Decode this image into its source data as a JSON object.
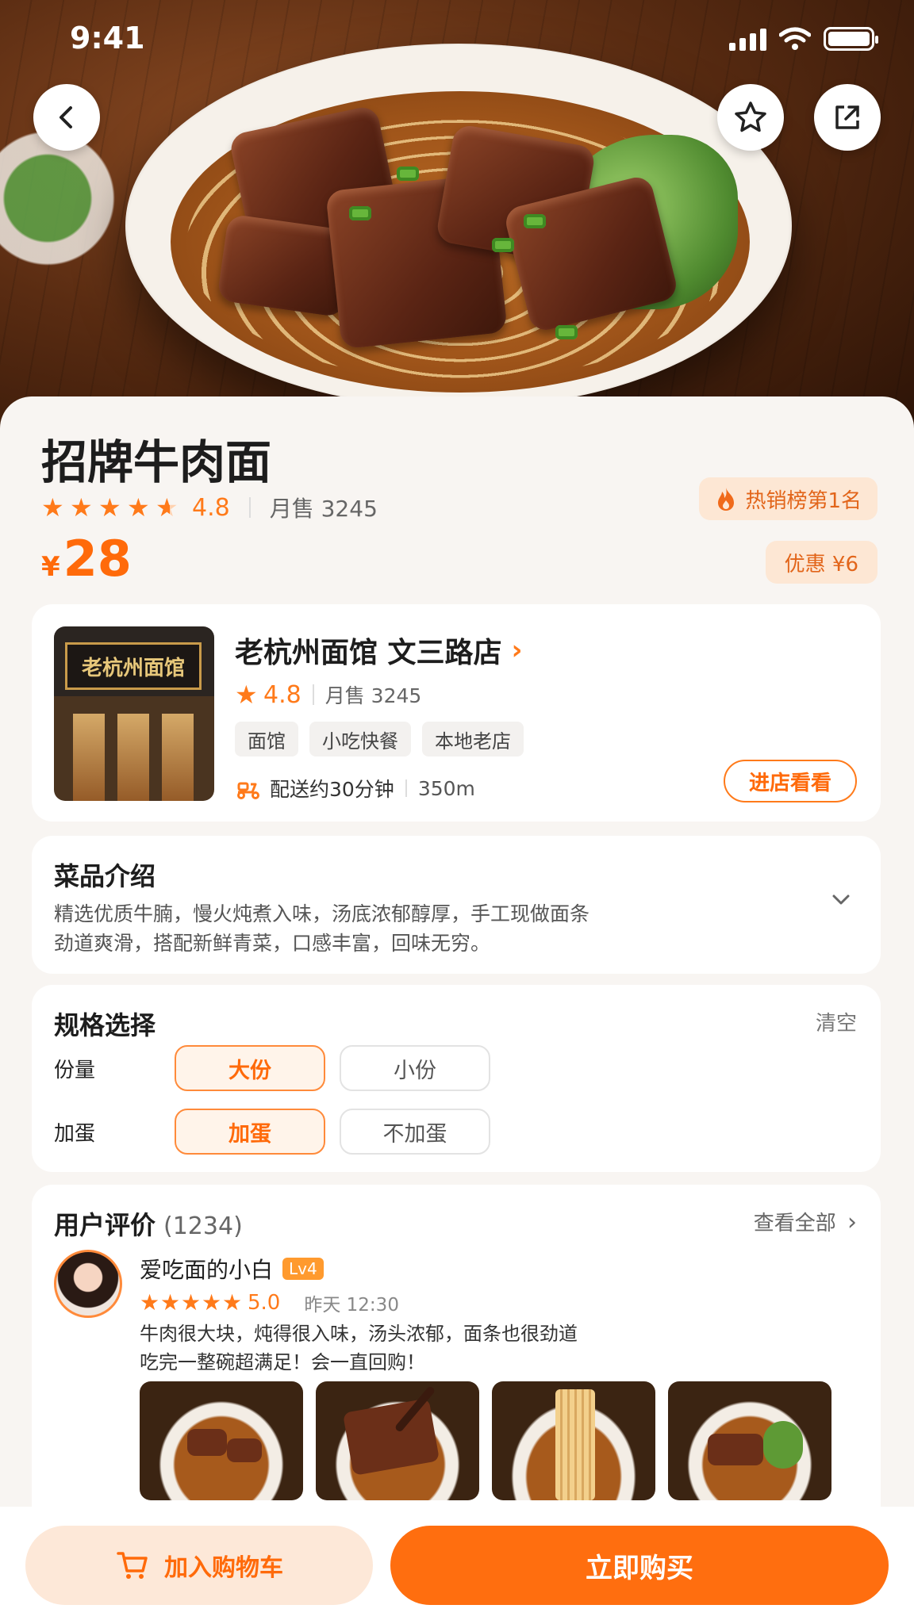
{
  "status_bar": {
    "time": "9:41"
  },
  "colors": {
    "accent": "#ff6e0f",
    "accent_light": "#fde8d8",
    "star": "#ff7a1a"
  },
  "product": {
    "title": "招牌牛肉面",
    "rating": "4.8",
    "sales": "月售 3245",
    "currency": "¥",
    "price": "28",
    "hot_badge": "热销榜第1名",
    "discount_badge": "优惠 ¥6"
  },
  "shop": {
    "sign_text": "老杭州面馆",
    "name": "老杭州面馆 文三路店",
    "rating": "4.8",
    "sales": "月售 3245",
    "tags": [
      "面馆",
      "小吃快餐",
      "本地老店"
    ],
    "delivery": "配送约30分钟",
    "distance": "350m",
    "enter_label": "进店看看"
  },
  "description": {
    "title": "菜品介绍",
    "line1": "精选优质牛腩，慢火炖煮入味，汤底浓郁醇厚，手工现做面条",
    "line2": "劲道爽滑，搭配新鲜青菜，口感丰富，回味无穷。"
  },
  "spec": {
    "title": "规格选择",
    "clear_label": "清空",
    "groups": [
      {
        "label": "份量",
        "options": [
          "大份",
          "小份"
        ],
        "selected": 0
      },
      {
        "label": "加蛋",
        "options": [
          "加蛋",
          "不加蛋"
        ],
        "selected": 0
      }
    ]
  },
  "reviews": {
    "title": "用户评价",
    "count": "(1234)",
    "see_all": "查看全部",
    "item": {
      "user": "爱吃面的小白",
      "level": "Lv4",
      "rating": "5.0",
      "date": "昨天 12:30",
      "line1": "牛肉很大块，炖得很入味，汤头浓郁，面条也很劲道",
      "line2": "吃完一整碗超满足！会一直回购！"
    }
  },
  "bottom_bar": {
    "cart_label": "加入购物车",
    "buy_label": "立即购买"
  }
}
